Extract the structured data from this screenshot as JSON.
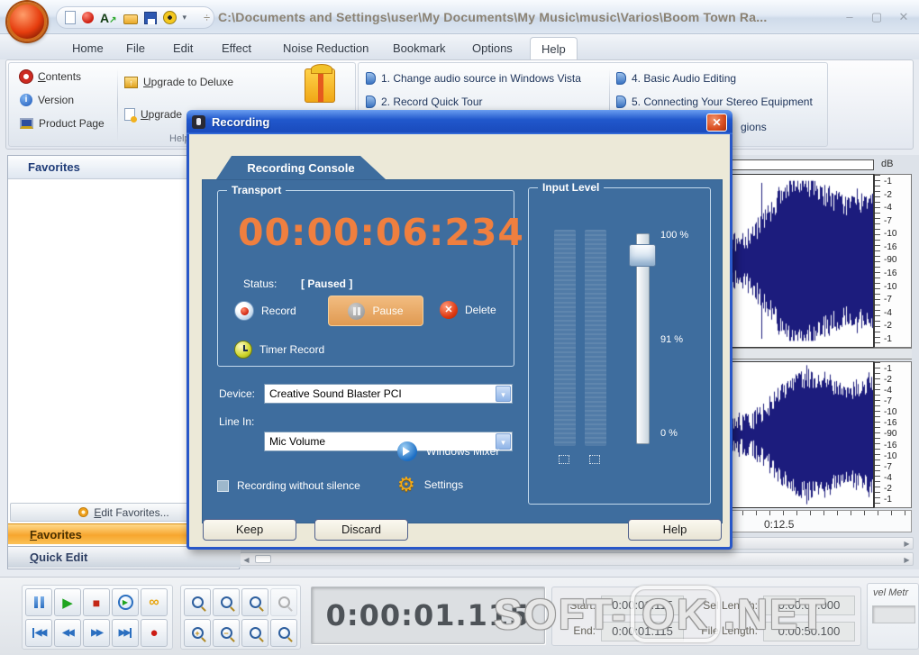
{
  "colors": {
    "dialog_blue": "#3e6d9e",
    "timer_orange": "#ef7f3f",
    "pause_orange": "#e8a45f",
    "favorites_orange": "#f7a62e",
    "waveform_navy": "#1c1c7d",
    "xp_title_blue": "#2158cc"
  },
  "icons": {
    "title_sep": "÷",
    "dropdown_caret": "▾",
    "minimize": "–",
    "maximize": "▢",
    "close": "✕",
    "dialog_close": "✕",
    "combo_arrow": "▾",
    "play": "▶",
    "stop": "■",
    "record": "●",
    "loop": "∞",
    "rewind": "◀◀",
    "forward": "▶▶",
    "left_arrow": "◀",
    "right_arrow": "▶",
    "gear": "⚙",
    "info": "i",
    "play_small": "▶",
    "zoom_plus": "+",
    "zoom_minus": "−"
  },
  "window": {
    "title": "C:\\Documents and Settings\\user\\My Documents\\My Music\\music\\Varios\\Boom Town Ra..."
  },
  "menu": {
    "tabs": [
      "Home",
      "File",
      "Edit",
      "Effect",
      "Noise Reduction",
      "Bookmark",
      "Options",
      "Help"
    ]
  },
  "ribbon": {
    "group_label": "Help",
    "items_left": [
      "Contents",
      "Version",
      "Product Page"
    ],
    "items_upgrade": [
      "Upgrade to Deluxe",
      "Upgrade"
    ],
    "topics": [
      "1. Change audio source in Windows Vista",
      "2. Record Quick Tour",
      "4. Basic Audio Editing",
      "5. Connecting Your Stereo Equipment"
    ],
    "partial_topic": "gions"
  },
  "sidebar": {
    "header": "Favorites",
    "edit_button": "Edit Favorites...",
    "tab_favorites": "Favorites",
    "tab_quick_edit": "Quick Edit"
  },
  "dialog": {
    "title": "Recording",
    "tab": "Recording Console",
    "transport": {
      "label": "Transport",
      "time": "00:00:06:234",
      "status_label": "Status:",
      "status_value": "[ Paused ]",
      "record": "Record",
      "pause": "Pause",
      "delete": "Delete",
      "timer_record": "Timer Record"
    },
    "device_label": "Device:",
    "device_value": "Creative Sound Blaster PCI",
    "line_in_label": "Line In:",
    "line_in_value": "Mic Volume",
    "mixer_label": "Windows Mixer",
    "silence_label": "Recording without silence",
    "settings_label": "Settings",
    "input": {
      "label": "Input Level",
      "top": "100 %",
      "mid": "91 %",
      "bottom": "0 %"
    },
    "buttons": {
      "keep": "Keep",
      "discard": "Discard",
      "help": "Help"
    }
  },
  "waveform": {
    "db_label": "dB",
    "scale": [
      "-1",
      "-2",
      "-4",
      "-7",
      "-10",
      "-16",
      "-90",
      "-16",
      "-10",
      "-7",
      "-4",
      "-2",
      "-1"
    ],
    "timeline_label": "0:12.5"
  },
  "bottom": {
    "time_display": "0:00:01.115",
    "start_label": "Start:",
    "start_value": "0:00:01.115",
    "end_label": "End:",
    "end_value": "0:00:01.115",
    "sel_label": "Sel Length:",
    "sel_value": "0:00:00.000",
    "file_label": "File Length:",
    "file_value": "0:00:50.100",
    "meter_label": "vel Metr"
  },
  "watermark": {
    "part1": "SOFT-",
    "part2": "OK",
    "part3": ".NET"
  }
}
